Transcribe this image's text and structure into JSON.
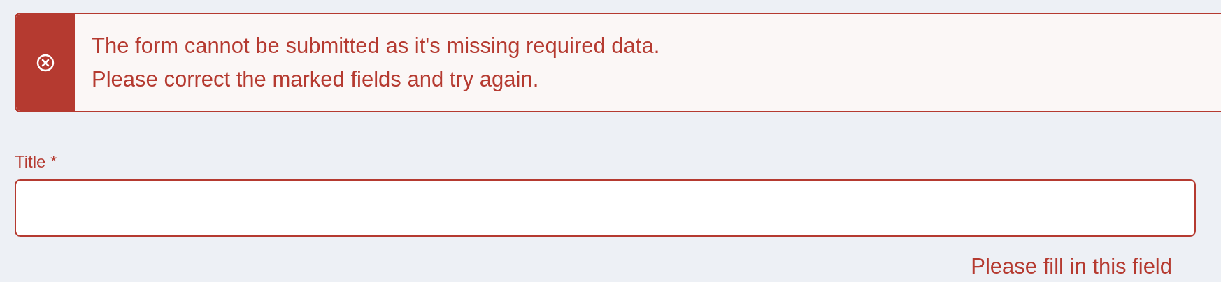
{
  "alert": {
    "kind": "error",
    "lines": [
      "The form cannot be submitted as it's missing required data.",
      "Please correct the marked fields and try again."
    ]
  },
  "field": {
    "label": "Title *",
    "invalid": true,
    "error": "Please fill in this field"
  }
}
